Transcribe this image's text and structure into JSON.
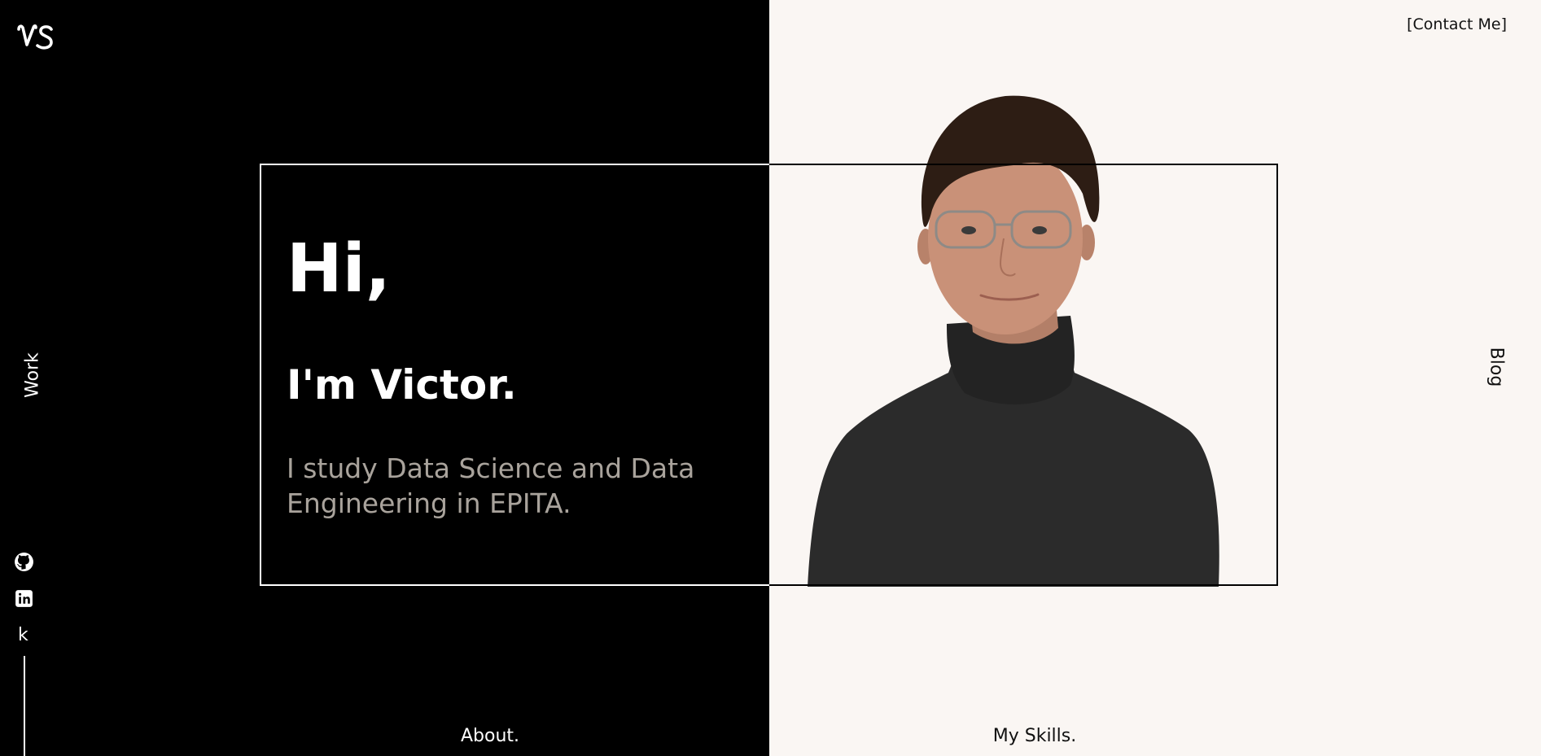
{
  "header": {
    "logo_text": "VS",
    "contact_label": "[Contact Me]"
  },
  "side_nav": {
    "left_label": "Work",
    "right_label": "Blog"
  },
  "social": {
    "icons": [
      "github-icon",
      "linkedin-icon"
    ],
    "k_label": "k"
  },
  "hero": {
    "greeting": "Hi,",
    "name_line": "I'm Victor.",
    "description": "I study Data Science and Data Engineering in EPITA."
  },
  "bottom_nav": {
    "about_label": "About.",
    "skills_label": "My Skills."
  },
  "colors": {
    "left_background": "#000000",
    "right_background": "#faf6f3",
    "description_text": "#a9a39c",
    "sweater": "#2b2b2b",
    "hair": "#2d1d14",
    "skin": "#c99178"
  }
}
